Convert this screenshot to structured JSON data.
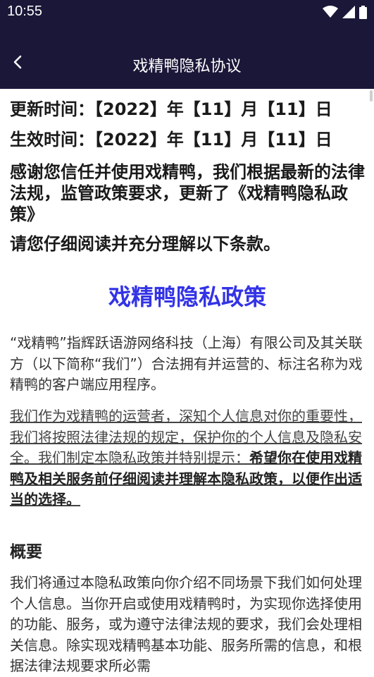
{
  "status_bar": {
    "time": "10:55"
  },
  "app_bar": {
    "title": "戏精鸭隐私协议"
  },
  "content": {
    "updated": "更新时间：【2022】年【11】月【11】日",
    "effective": "生效时间：【2022】年【11】月【11】日",
    "thanks": "感谢您信任并使用戏精鸭，我们根据最新的法律法规，监管政策要求，更新了《戏精鸭隐私政策》",
    "please_read": "请您仔细阅读并充分理解以下条款。",
    "policy_title": "戏精鸭隐私政策",
    "intro": "“戏精鸭”指辉跃语游网络科技（上海）有限公司及其关联方（以下简称“我们”）合法拥有并运营的、标注名称为戏精鸭的客户端应用程序。",
    "underlined_normal": "我们作为戏精鸭的运营者，深知个人信息对你的重要性，我们将按照法律法规的规定，保护你的个人信息及隐私安全。我们制定本隐私政策并特别提示：",
    "underlined_bold": "希望你在使用戏精鸭及相关服务前仔细阅读并理解本隐私政策，以便作出适当的选择。",
    "overview_heading": "概要",
    "overview_text": "我们将通过本隐私政策向你介绍不同场景下我们如何处理个人信息。当你开启或使用戏精鸭时，为实现你选择使用的功能、服务，或为遵守法律法规的要求，我们会处理相关信息。除实现戏精鸭基本功能、服务所需的信息，和根据法律法规要求所必需"
  }
}
